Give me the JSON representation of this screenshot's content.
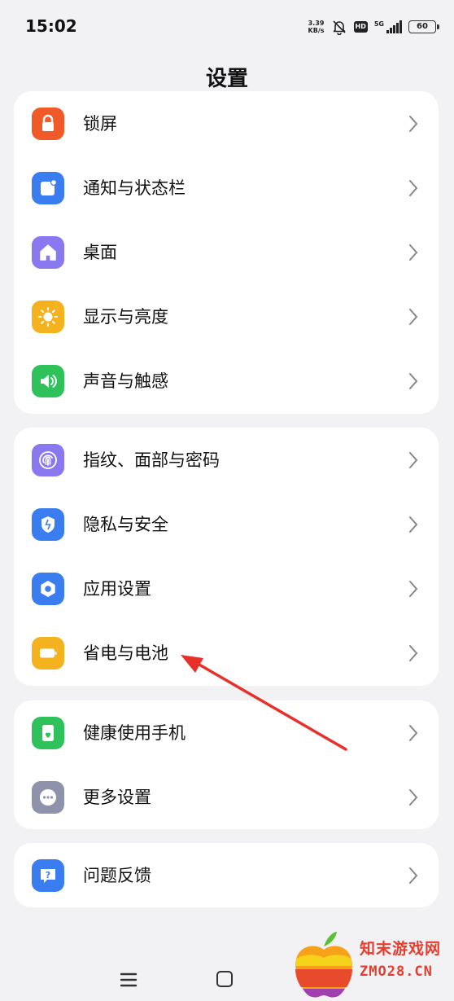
{
  "status_bar": {
    "time": "15:02",
    "net_speed_value": "3.39",
    "net_speed_unit": "KB/s",
    "hd": "HD",
    "signal_type": "5G",
    "battery": "60"
  },
  "header": {
    "title": "设置"
  },
  "groups": [
    {
      "items": [
        {
          "label": "锁屏",
          "icon": "lock-icon",
          "color": "#f05a28"
        },
        {
          "label": "通知与状态栏",
          "icon": "notification-icon",
          "color": "#3a7df0"
        },
        {
          "label": "桌面",
          "icon": "home-icon",
          "color": "#8a78f0"
        },
        {
          "label": "显示与亮度",
          "icon": "sun-icon",
          "color": "#f5b21f"
        },
        {
          "label": "声音与触感",
          "icon": "speaker-icon",
          "color": "#2fc25b"
        }
      ]
    },
    {
      "items": [
        {
          "label": "指纹、面部与密码",
          "icon": "fingerprint-icon",
          "color": "#8a78f0"
        },
        {
          "label": "隐私与安全",
          "icon": "shield-icon",
          "color": "#3a7df0"
        },
        {
          "label": "应用设置",
          "icon": "app-settings-icon",
          "color": "#3a7df0"
        },
        {
          "label": "省电与电池",
          "icon": "battery-icon",
          "color": "#f5b21f"
        }
      ]
    },
    {
      "items": [
        {
          "label": "健康使用手机",
          "icon": "health-phone-icon",
          "color": "#2fc25b"
        },
        {
          "label": "更多设置",
          "icon": "more-icon",
          "color": "#8e93ab"
        }
      ]
    },
    {
      "items": [
        {
          "label": "问题反馈",
          "icon": "feedback-icon",
          "color": "#3a7df0"
        }
      ]
    }
  ],
  "watermark": {
    "text": "知末游戏网",
    "sub": "ZMO28.CN"
  }
}
